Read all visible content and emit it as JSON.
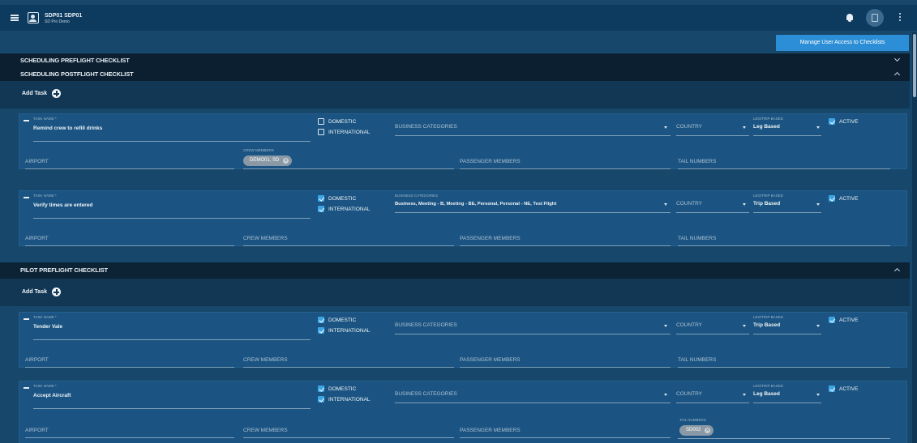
{
  "header": {
    "user_name": "SDP01 SDP01",
    "user_org": "SD Pro Demo"
  },
  "manage_button": "Manage User Access to Checklists",
  "labels": {
    "task_name": "TASK NAME *",
    "domestic": "DOMESTIC",
    "international": "INTERNATIONAL",
    "business_categories": "BUSINESS CATEGORIES",
    "country": "COUNTRY",
    "leg_trip_based": "LEG/TRIP BASED",
    "active": "ACTIVE",
    "airport": "AIRPORT",
    "crew_members": "CREW MEMBERS",
    "passenger_members": "PASSENGER MEMBERS",
    "tail_numbers": "TAIL NUMBERS",
    "add_task": "Add Task"
  },
  "sections": [
    {
      "title": "SCHEDULING PREFLIGHT CHECKLIST",
      "expanded": false
    },
    {
      "title": "SCHEDULING POSTFLIGHT CHECKLIST",
      "expanded": true
    },
    {
      "title": "PILOT PREFLIGHT CHECKLIST",
      "expanded": true
    }
  ],
  "tasks": [
    {
      "task_name": "Remind crew to refill drinks",
      "domestic": false,
      "international": false,
      "business_categories": "",
      "leg_trip": "Leg Based",
      "active": true,
      "crew_chip": "DEMO01, SD",
      "tail_chip": ""
    },
    {
      "task_name": "Verify times are entered",
      "domestic": true,
      "international": true,
      "business_categories": "Business, Meeting - B, Meeting - BE, Personal, Personal - NE, Test Flight",
      "leg_trip": "Trip Based",
      "active": true,
      "crew_chip": "",
      "tail_chip": ""
    },
    {
      "task_name": "Tender Vale",
      "domestic": true,
      "international": true,
      "business_categories": "",
      "leg_trip": "Trip Based",
      "active": true,
      "crew_chip": "",
      "tail_chip": ""
    },
    {
      "task_name": "Accept Aircraft",
      "domestic": true,
      "international": true,
      "business_categories": "",
      "leg_trip": "Leg Based",
      "active": true,
      "crew_chip": "",
      "tail_chip": "SD002"
    }
  ],
  "colors": {
    "page_bg": "#17476a",
    "topbar_bg": "#0d3b5f",
    "section_header_bg": "#0b1f30",
    "card_bg": "#1b5482",
    "accent": "#2c8ed6",
    "checkbox_on": "#3ba4e4"
  }
}
